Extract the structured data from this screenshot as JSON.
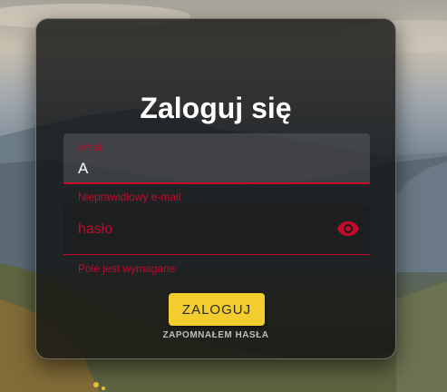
{
  "login": {
    "title": "Zaloguj się",
    "email": {
      "label": "email",
      "value": "A",
      "error": "Nieprawidłowy e-mail"
    },
    "password": {
      "label": "hasło",
      "error": "Pole jest wymagane",
      "toggle_icon": "eye-icon"
    },
    "submit_label": "ZALOGUJ",
    "forgot_label": "ZAPOMNAŁEM HASŁA"
  },
  "colors": {
    "error": "#c30a2a",
    "button": "#f3cd2e",
    "card": "#0f0f0f"
  }
}
